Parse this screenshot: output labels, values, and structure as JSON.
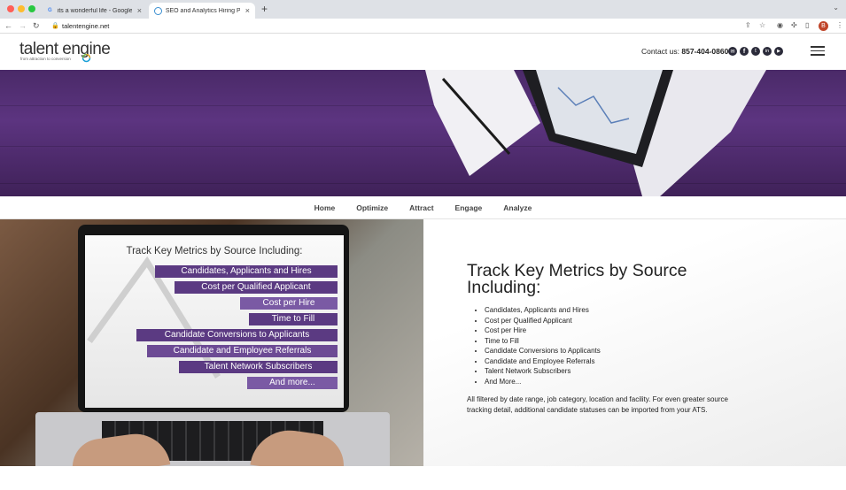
{
  "browser": {
    "tabs": [
      {
        "label": "its a wonderful life - Google Se",
        "icon": "google-icon"
      },
      {
        "label": "SEO and Analytics Hiring Platfo",
        "icon": "talentengine-favicon"
      }
    ],
    "new_tab": "+",
    "url": "talentengine.net",
    "profile_initial": "B"
  },
  "header": {
    "logo_text_a": "talent",
    "logo_text_b": "engine",
    "logo_tagline": "from attraction to conversion",
    "contact_label": "Contact us:",
    "phone": "857-404-0860",
    "social_icons": [
      "email-icon",
      "facebook-icon",
      "twitter-icon",
      "linkedin-icon",
      "youtube-icon"
    ]
  },
  "nav": {
    "items": [
      "Home",
      "Optimize",
      "Attract",
      "Engage",
      "Analyze"
    ]
  },
  "screen_slide": {
    "title": "Track Key Metrics by Source Including:",
    "bars": [
      "Candidates, Applicants and Hires",
      "Cost per Qualified Applicant",
      "Cost per Hire",
      "Time to Fill",
      "Candidate Conversions to Applicants",
      "Candidate and Employee Referrals",
      "Talent Network Subscribers",
      "And more..."
    ]
  },
  "content": {
    "heading": "Track Key Metrics by Source Including:",
    "list": [
      "Candidates, Applicants and Hires",
      "Cost per Qualified Applicant",
      "Cost per Hire",
      "Time to Fill",
      "Candidate Conversions to Applicants",
      "Candidate and Employee Referrals",
      "Talent Network Subscribers",
      "And More..."
    ],
    "paragraph": "All filtered by date range, job category, location and facility. For even greater source tracking detail, additional candidate statuses can be imported from your ATS."
  },
  "colors": {
    "hero_purple": "#5c3480",
    "bar_purple": "#5b3a82",
    "logo_text": "#333333",
    "profile": "#c0452a"
  }
}
